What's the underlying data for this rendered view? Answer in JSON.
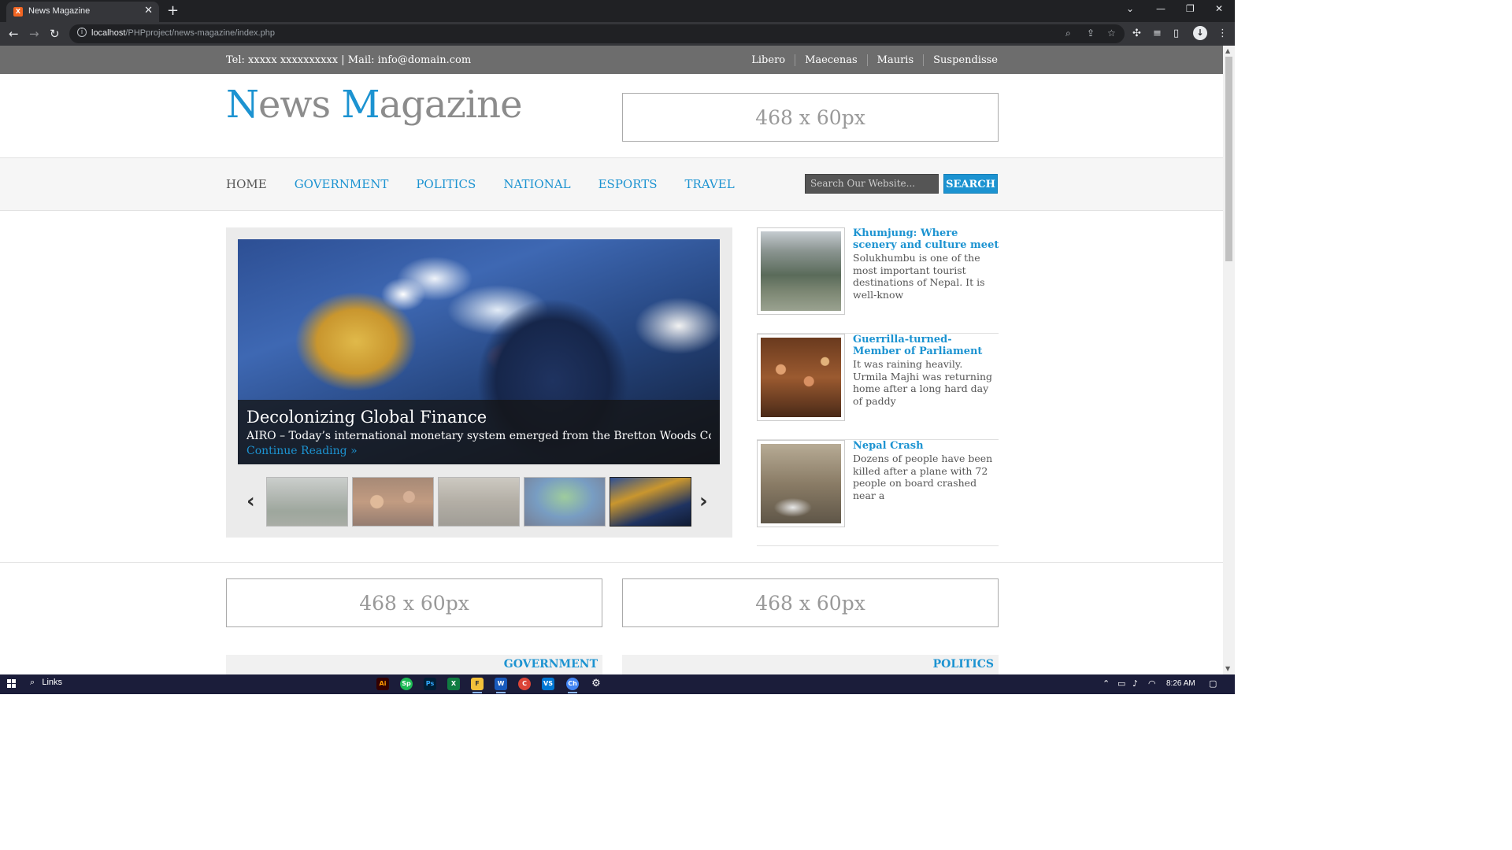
{
  "browser": {
    "tab_title": "News Magazine",
    "tab_close": "✕",
    "new_tab": "+",
    "url_host": "localhost",
    "url_path": "/PHPproject/news-magazine/index.php",
    "window_controls": [
      "⌄",
      "—",
      "❐",
      "✕"
    ]
  },
  "top_bar": {
    "contact": "Tel: xxxxx xxxxxxxxxx | Mail: info@domain.com",
    "links": [
      "Libero",
      "Maecenas",
      "Mauris",
      "Suspendisse"
    ]
  },
  "header": {
    "logo_n": "N",
    "logo_ews": "ews ",
    "logo_m": "M",
    "logo_agazine": "agazine",
    "ad_text": "468 x 60px"
  },
  "nav": {
    "items": [
      "HOME",
      "GOVERNMENT",
      "POLITICS",
      "NATIONAL",
      "ESPORTS",
      "TRAVEL"
    ],
    "search_placeholder": "Search Our Website...",
    "search_button": "SEARCH"
  },
  "slider": {
    "title": "Decolonizing Global Finance",
    "text": "AIRO – Today’s international monetary system emerged from the Bretton Woods Confer",
    "link": "Continue Reading »",
    "prev": "‹",
    "next": "›",
    "thumbnails": [
      "mountain-village",
      "parliament",
      "plane-crash",
      "map-event",
      "currency-exchange"
    ]
  },
  "sidebar": [
    {
      "title": "Khumjung: Where scenery and culture meet",
      "text": "Solukhumbu is one of the most important tourist destinations of Nepal. It is well-know"
    },
    {
      "title": "Guerrilla-turned-Member of Parliament",
      "text": "It was raining heavily. Urmila Majhi was returning home after a long hard day of paddy"
    },
    {
      "title": "Nepal Crash",
      "text": "Dozens of people have been killed after a plane with 72 people on board crashed near a"
    }
  ],
  "ads": {
    "left": "468 x 60px",
    "right": "468 x 60px"
  },
  "sections": [
    "GOVERNMENT",
    "POLITICS"
  ],
  "taskbar": {
    "search_label": "Links",
    "time": "8:26 AM",
    "apps": [
      "Ai",
      "Sp",
      "Ps",
      "X",
      "F",
      "W",
      "C",
      "VS",
      "Ch",
      "⚙"
    ]
  },
  "colors": {
    "accent": "#1c93d1",
    "topbar": "#6d6d6d",
    "text": "#555555"
  }
}
